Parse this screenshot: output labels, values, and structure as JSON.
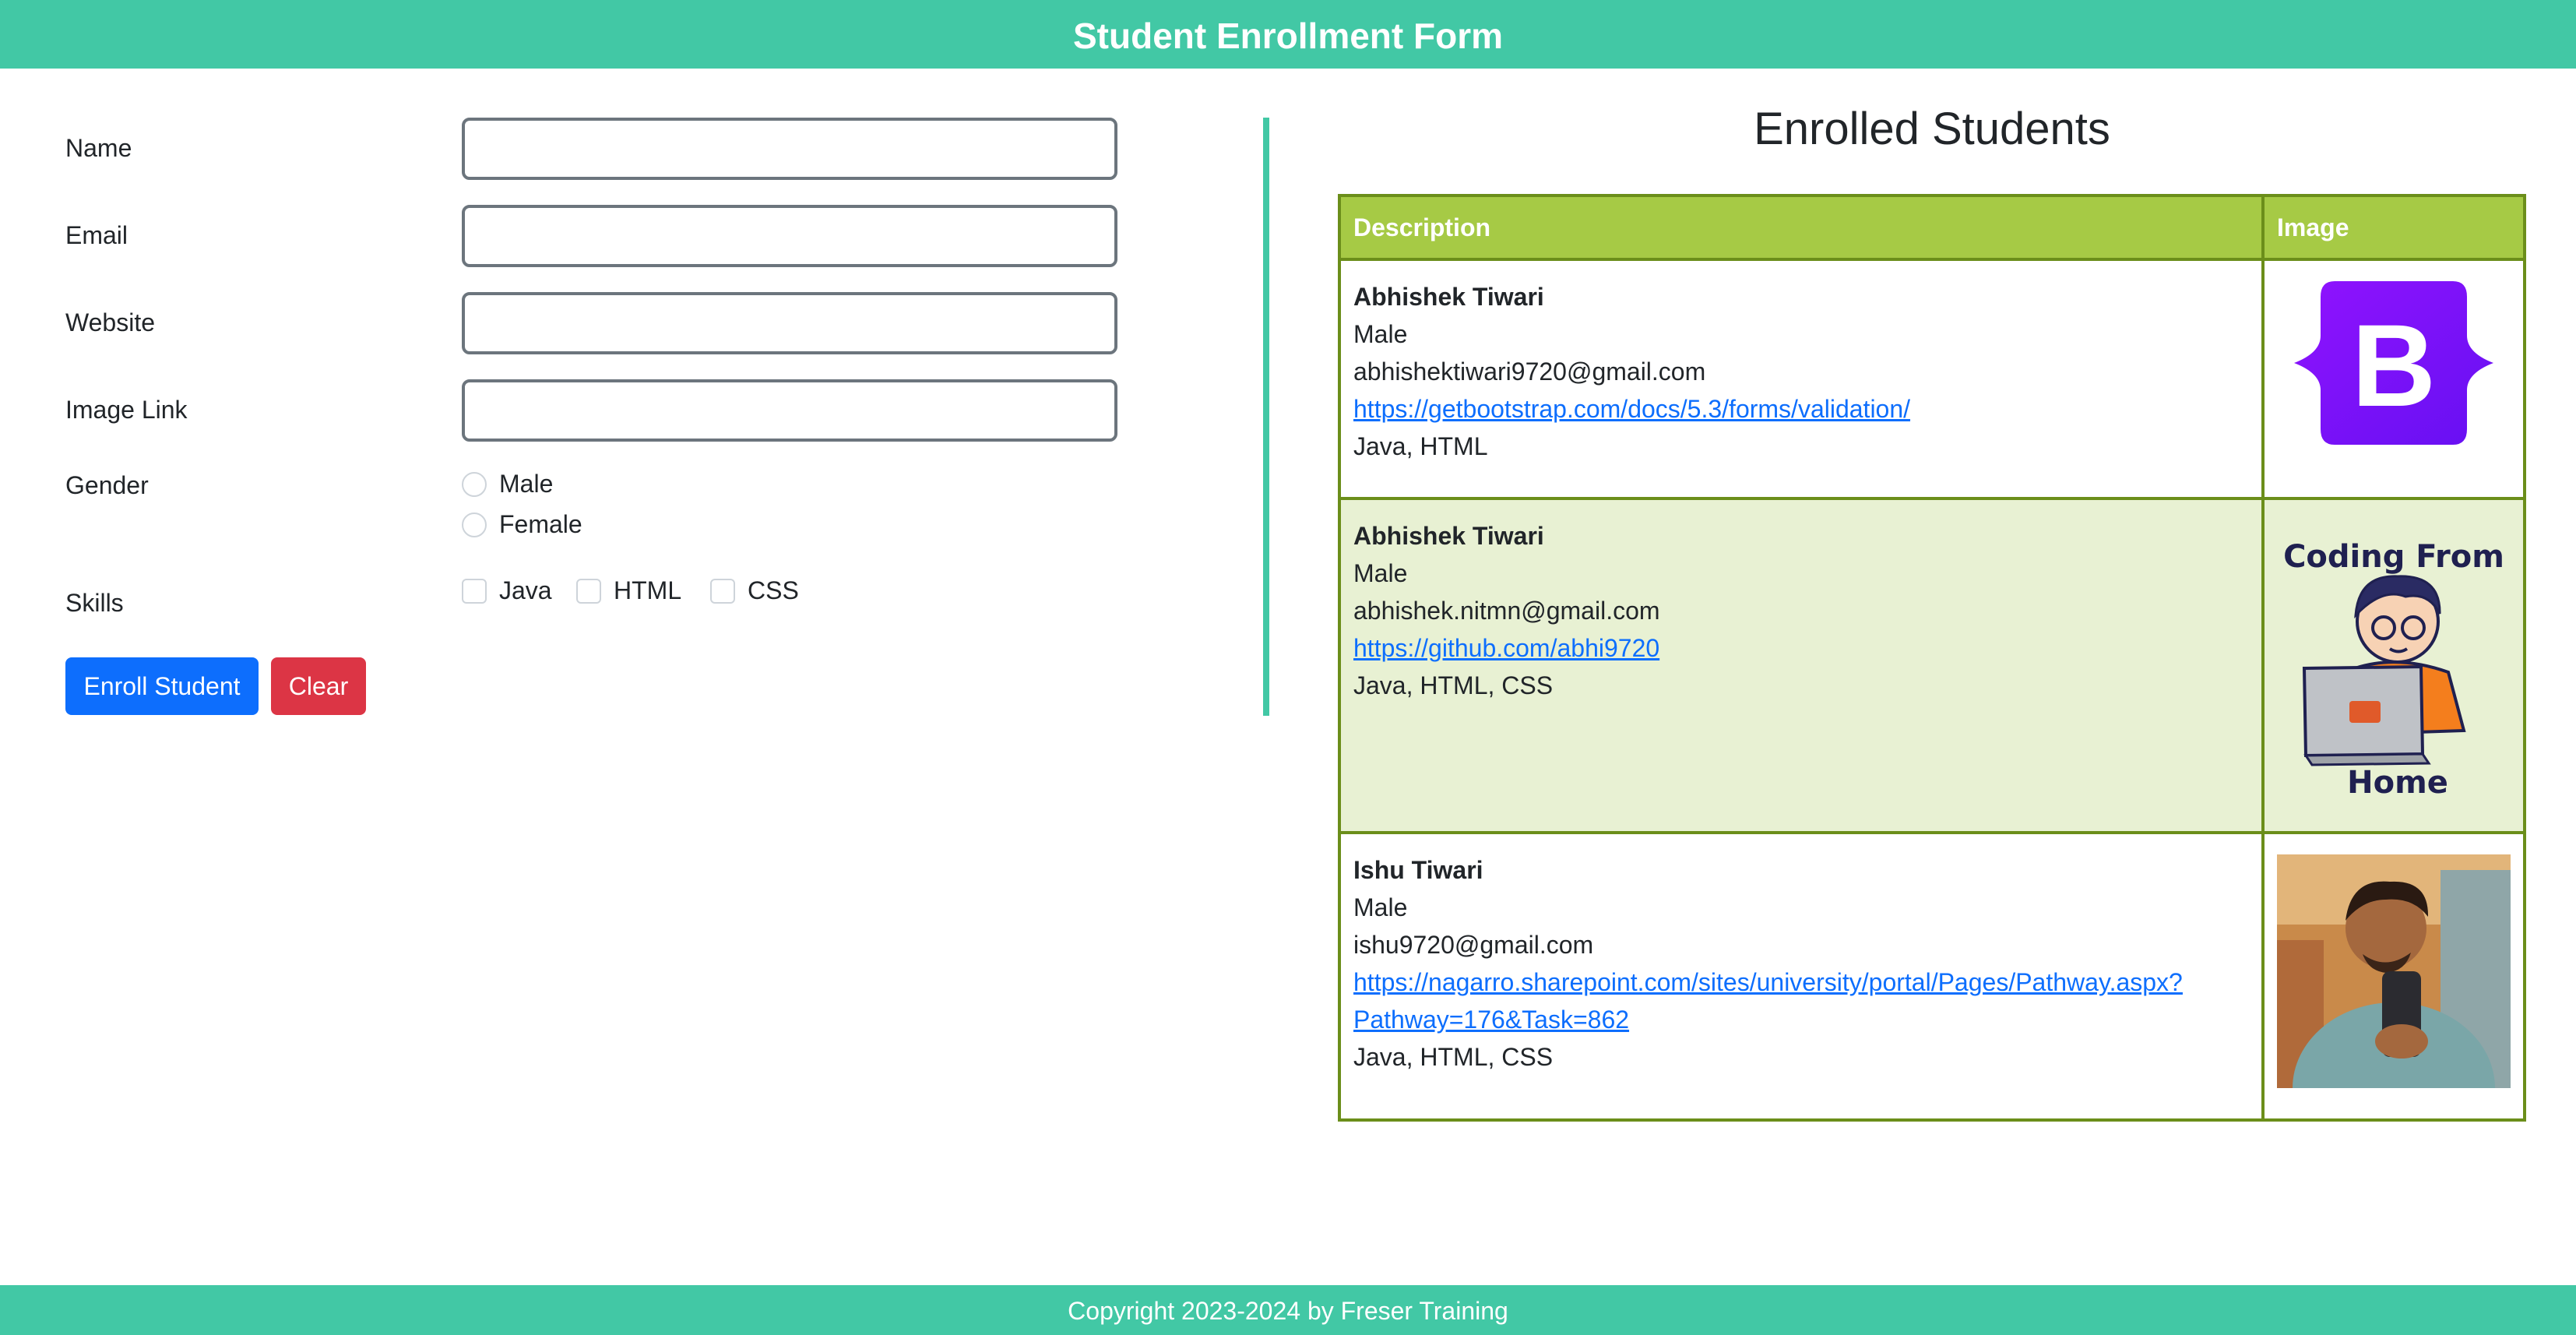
{
  "header": {
    "title": "Student Enrollment Form"
  },
  "form": {
    "name_label": "Name",
    "name_value": "",
    "email_label": "Email",
    "email_value": "",
    "website_label": "Website",
    "website_value": "",
    "image_label": "Image Link",
    "image_value": "",
    "gender_label": "Gender",
    "gender_options": [
      "Male",
      "Female"
    ],
    "skills_label": "Skills",
    "skills_options": [
      "Java",
      "HTML",
      "CSS"
    ],
    "enroll_button": "Enroll Student",
    "clear_button": "Clear"
  },
  "students_panel": {
    "title": "Enrolled Students",
    "columns": [
      "Description",
      "Image"
    ],
    "rows": [
      {
        "name": "Abhishek Tiwari",
        "gender": "Male",
        "email": "abhishektiwari9720@gmail.com",
        "website": "https://getbootstrap.com/docs/5.3/forms/validation/",
        "skills": "Java, HTML",
        "image": "bootstrap-logo-icon"
      },
      {
        "name": "Abhishek Tiwari",
        "gender": "Male",
        "email": "abhishek.nitmn@gmail.com",
        "website": "https://github.com/abhi9720",
        "skills": "Java, HTML, CSS",
        "image": "coding-from-home-illustration",
        "image_caption_top": "Coding From",
        "image_caption_bottom": "Home"
      },
      {
        "name": "Ishu Tiwari",
        "gender": "Male",
        "email": "ishu9720@gmail.com",
        "website_line1": "https://nagarro.sharepoint.com/sites/university/portal/Pages/Pathway.aspx?",
        "website_line2": "Pathway=176&Task=862",
        "skills": "Java, HTML, CSS",
        "image": "person-selfie-photo"
      }
    ]
  },
  "footer": {
    "text": "Copyright 2023-2024 by Freser Training"
  },
  "colors": {
    "accent": "#42c8a5",
    "table_header": "#a6ca45",
    "table_border": "#6b8e1a",
    "row_alt": "#e8f1d3",
    "primary_button": "#0d6efd",
    "danger_button": "#dc3545",
    "link": "#0d6efd"
  }
}
